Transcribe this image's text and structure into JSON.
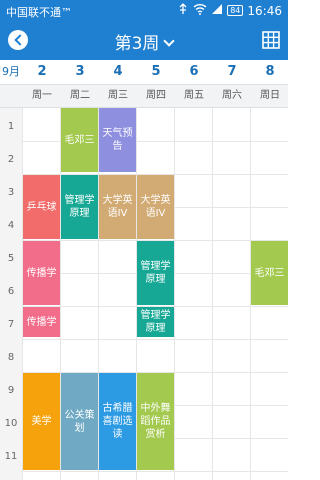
{
  "status_bar": {
    "carrier": "中国联不通™",
    "battery": "84",
    "time": "16:46"
  },
  "header": {
    "title": "第3周"
  },
  "dates": {
    "month": "9月",
    "days": [
      "2",
      "3",
      "4",
      "5",
      "6",
      "7",
      "8"
    ]
  },
  "weekdays": [
    "周一",
    "周二",
    "周三",
    "周四",
    "周五",
    "周六",
    "周日"
  ],
  "periods": [
    "1",
    "2",
    "3",
    "4",
    "5",
    "6",
    "7",
    "8",
    "9",
    "10",
    "11"
  ],
  "courses": {
    "maodengsan_tue": "毛邓三",
    "weather": "天气预告",
    "pingpong": "乒乓球",
    "mgmt_tue": "管理学原理",
    "english_wed": "大学英语IV",
    "english_thu": "大学英语IV",
    "maodengsan_sun": "毛邓三",
    "comm_a": "传播学",
    "mgmt_thu_a": "管理学原理",
    "comm_b": "传播学",
    "mgmt_thu_b": "管理学原理",
    "art": "美学",
    "public_policy": "公关策划",
    "greek": "古希腊喜剧选读",
    "dance": "中外舞蹈作品赏析"
  },
  "colors": {
    "primary": "#1f7fd0",
    "green": "#a3c94f",
    "purple": "#8f8fe0",
    "salmon": "#f26c6c",
    "teal": "#17a895",
    "tan": "#d2aa74",
    "pink": "#f26d8a",
    "orange": "#f6a20d",
    "steel": "#6fa9c3",
    "skyblue": "#2d9be3"
  }
}
